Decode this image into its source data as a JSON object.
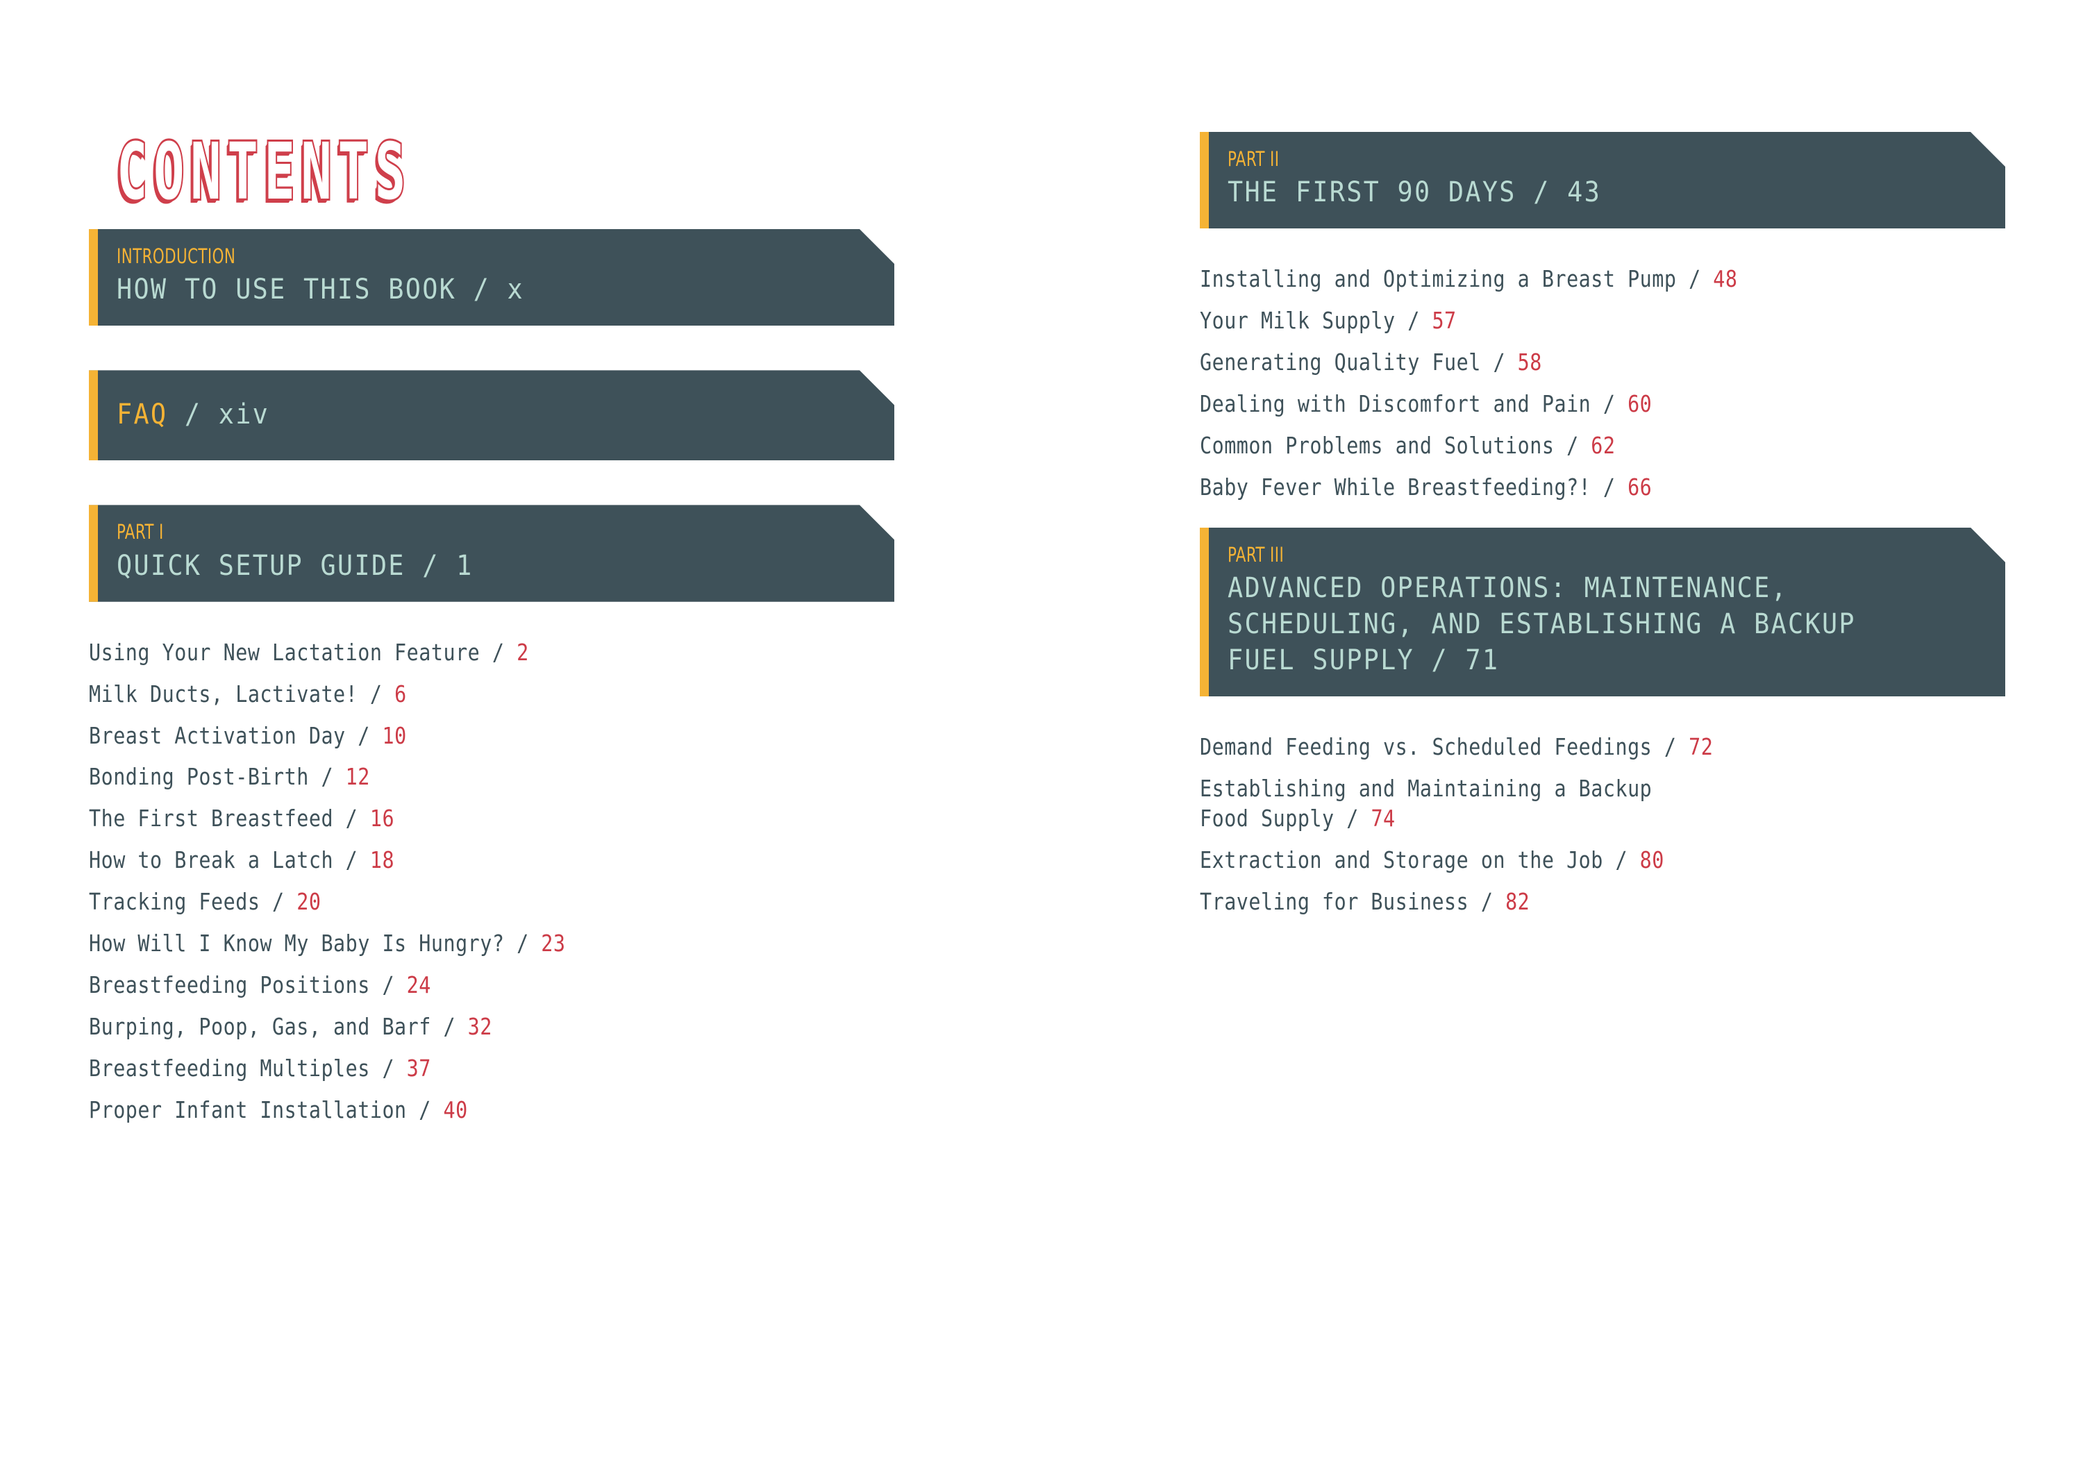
{
  "page": {
    "title": "CONTENTS",
    "background": "#ffffff"
  },
  "colors": {
    "accent_yellow": "#f5b335",
    "banner_slate": "#3e5159",
    "title_mint": "#b9dad2",
    "page_number_red": "#cc3b47",
    "heading_red": "#cf3f4b",
    "entry_text": "#3e5159"
  },
  "left_column": {
    "banners": {
      "introduction": {
        "label": "INTRODUCTION",
        "title": "HOW TO USE THIS BOOK / x"
      },
      "faq": {
        "keyword": "FAQ",
        "rest": " / xiv"
      },
      "part_one": {
        "label": "PART I",
        "title": "QUICK SETUP GUIDE / 1"
      }
    },
    "part_one_entries": [
      {
        "text": "Using Your New Lactation Feature / ",
        "page": "2"
      },
      {
        "text": "Milk Ducts, Lactivate! / ",
        "page": "6"
      },
      {
        "text": "Breast Activation Day / ",
        "page": "10"
      },
      {
        "text": "Bonding Post-Birth / ",
        "page": "12"
      },
      {
        "text": "The First Breastfeed / ",
        "page": "16"
      },
      {
        "text": "How to Break a Latch / ",
        "page": "18"
      },
      {
        "text": "Tracking Feeds / ",
        "page": "20"
      },
      {
        "text": "How Will I Know My Baby Is Hungry? / ",
        "page": "23"
      },
      {
        "text": "Breastfeeding Positions / ",
        "page": "24"
      },
      {
        "text": "Burping, Poop, Gas, and Barf / ",
        "page": "32"
      },
      {
        "text": "Breastfeeding Multiples / ",
        "page": "37"
      },
      {
        "text": "Proper Infant Installation / ",
        "page": "40"
      }
    ]
  },
  "right_column": {
    "banners": {
      "part_two": {
        "label": "PART II",
        "title": "THE FIRST 90 DAYS / 43"
      },
      "part_three": {
        "label": "PART III",
        "title": "ADVANCED OPERATIONS: MAINTENANCE,\nSCHEDULING, AND ESTABLISHING A BACKUP\nFUEL SUPPLY / 71"
      }
    },
    "part_two_entries": [
      {
        "text": "Installing and Optimizing a Breast Pump / ",
        "page": "48"
      },
      {
        "text": "Your Milk Supply / ",
        "page": "57"
      },
      {
        "text": "Generating Quality Fuel / ",
        "page": "58"
      },
      {
        "text": "Dealing with Discomfort and Pain / ",
        "page": "60"
      },
      {
        "text": "Common Problems and Solutions / ",
        "page": "62"
      },
      {
        "text": "Baby Fever While Breastfeeding?! / ",
        "page": "66"
      }
    ],
    "part_three_entries": [
      {
        "text": "Demand Feeding vs. Scheduled Feedings / ",
        "page": "72"
      },
      {
        "text": "Establishing and Maintaining a Backup\nFood Supply / ",
        "page": "74"
      },
      {
        "text": "Extraction and Storage on the Job / ",
        "page": "80"
      },
      {
        "text": "Traveling for Business / ",
        "page": "82"
      }
    ]
  }
}
